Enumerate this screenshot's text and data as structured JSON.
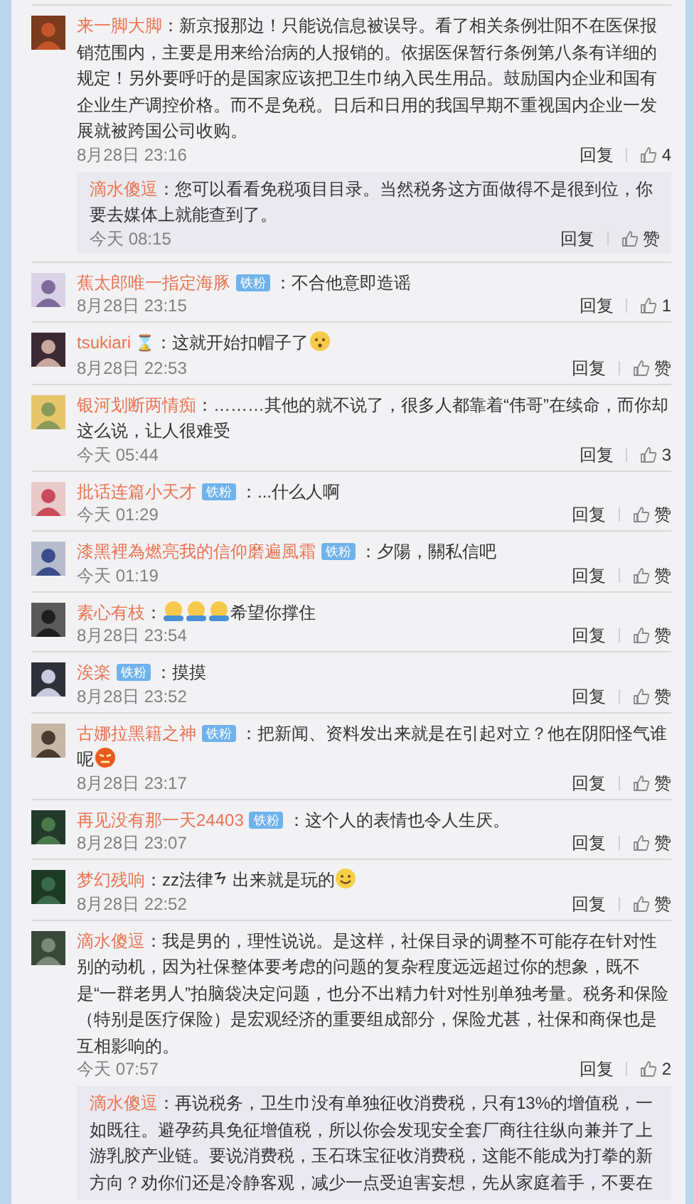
{
  "comments": [
    {
      "user": "来一脚大脚",
      "parts": [
        {
          "kind": "text",
          "text": "：新京报那边！只能说信息被误导。看了相关条例壮阳不在医保报销范围内，主要是用来给治病的人报销的。依据医保暂行条例第八条有详细的规定！另外要呼吁的是国家应该把卫生巾纳入民生用品。鼓励国内企业和国有企业生产调控价格。而不是免税。日后和日用的我国早期不重视国内企业一发展就被跨国公司收购。"
        }
      ],
      "time": "8月28日 23:16",
      "reply": "回复",
      "likes": "4",
      "replies": [
        {
          "user": "滴水傻逗",
          "parts": [
            {
              "kind": "text",
              "text": "：您可以看看免税项目目录。当然税务这方面做得不是很到位，你要去媒体上就能查到了。"
            }
          ],
          "time": "今天 08:15",
          "reply": "回复",
          "likes": "赞"
        }
      ]
    },
    {
      "user": "蕉太郎唯一指定海豚",
      "badge": "铁粉",
      "parts": [
        {
          "kind": "text",
          "text": "：不合他意即造谣"
        }
      ],
      "time": "8月28日 23:15",
      "reply": "回复",
      "likes": "1"
    },
    {
      "user": "tsukiari",
      "name_icon": "⌛",
      "parts": [
        {
          "kind": "text",
          "text": "：这就开始扣帽子了"
        },
        {
          "kind": "think"
        }
      ],
      "time": "8月28日 22:53",
      "reply": "回复",
      "likes": "赞"
    },
    {
      "user": "银河划断两情痴",
      "parts": [
        {
          "kind": "text",
          "text": "：………其他的就不说了，很多人都靠着“伟哥”在续命，而你却这么说，让人很难受"
        }
      ],
      "time": "今天 05:44",
      "reply": "回复",
      "likes": "3"
    },
    {
      "user": "批话连篇小天才",
      "badge": "铁粉",
      "parts": [
        {
          "kind": "text",
          "text": "：...什么人啊"
        }
      ],
      "time": "今天 01:29",
      "reply": "回复",
      "likes": "赞"
    },
    {
      "user": "漆黑裡為燃亮我的信仰磨遍風霜",
      "badge": "铁粉",
      "parts": [
        {
          "kind": "text",
          "text": "：夕陽，關私信吧"
        }
      ],
      "time": "今天 01:19",
      "reply": "回复",
      "likes": "赞"
    },
    {
      "user": "素心有枝",
      "parts": [
        {
          "kind": "text",
          "text": "："
        },
        {
          "kind": "hug"
        },
        {
          "kind": "hug"
        },
        {
          "kind": "hug"
        },
        {
          "kind": "text",
          "text": "希望你撑住"
        }
      ],
      "time": "8月28日 23:54",
      "reply": "回复",
      "likes": "赞"
    },
    {
      "user": "涘楽",
      "badge": "铁粉",
      "parts": [
        {
          "kind": "text",
          "text": "：摸摸"
        }
      ],
      "time": "8月28日 23:52",
      "reply": "回复",
      "likes": "赞"
    },
    {
      "user": "古娜拉黑籍之神",
      "badge": "铁粉",
      "parts": [
        {
          "kind": "text",
          "text": "：把新闻、资料发出来就是在引起对立？他在阴阳怪气谁呢"
        },
        {
          "kind": "angry"
        }
      ],
      "time": "8月28日 23:17",
      "reply": "回复",
      "likes": "赞"
    },
    {
      "user": "再见没有那一天24403",
      "badge": "铁粉",
      "parts": [
        {
          "kind": "text",
          "text": "：这个人的表情也令人生厌。"
        }
      ],
      "time": "8月28日 23:07",
      "reply": "回复",
      "likes": "赞"
    },
    {
      "user": "梦幻残响",
      "parts": [
        {
          "kind": "text",
          "text": "：zz法律"
        },
        {
          "kind": "squiggle"
        },
        {
          "kind": "text",
          "text": " 出来就是玩的"
        },
        {
          "kind": "smile"
        }
      ],
      "time": "8月28日 22:52",
      "reply": "回复",
      "likes": "赞"
    },
    {
      "user": "滴水傻逗",
      "parts": [
        {
          "kind": "text",
          "text": "：我是男的，理性说说。是这样，社保目录的调整不可能存在针对性别的动机，因为社保整体要考虑的问题的复杂程度远远超过你的想象，既不是“一群老男人”拍脑袋决定问题，也分不出精力针对性别单独考量。税务和保险（特别是医疗保险）是宏观经济的重要组成部分，保险尤甚，社保和商保也是互相影响的。"
        }
      ],
      "time": "今天 07:57",
      "reply": "回复",
      "likes": "2",
      "replies": [
        {
          "user": "滴水傻逗",
          "parts": [
            {
              "kind": "text",
              "text": "：再说税务，卫生巾没有单独征收消费税，只有13%的增值税，一如既往。避孕药具免征增值税，所以你会发现安全套厂商往往纵向兼并了上游乳胶产业链。要说消费税，玉石珠宝征收消费税，这能不能成为打拳的新方向？劝你们还是冷静客观，减少一点受迫害妄想，先从家庭着手，不要在"
            }
          ]
        }
      ]
    }
  ]
}
